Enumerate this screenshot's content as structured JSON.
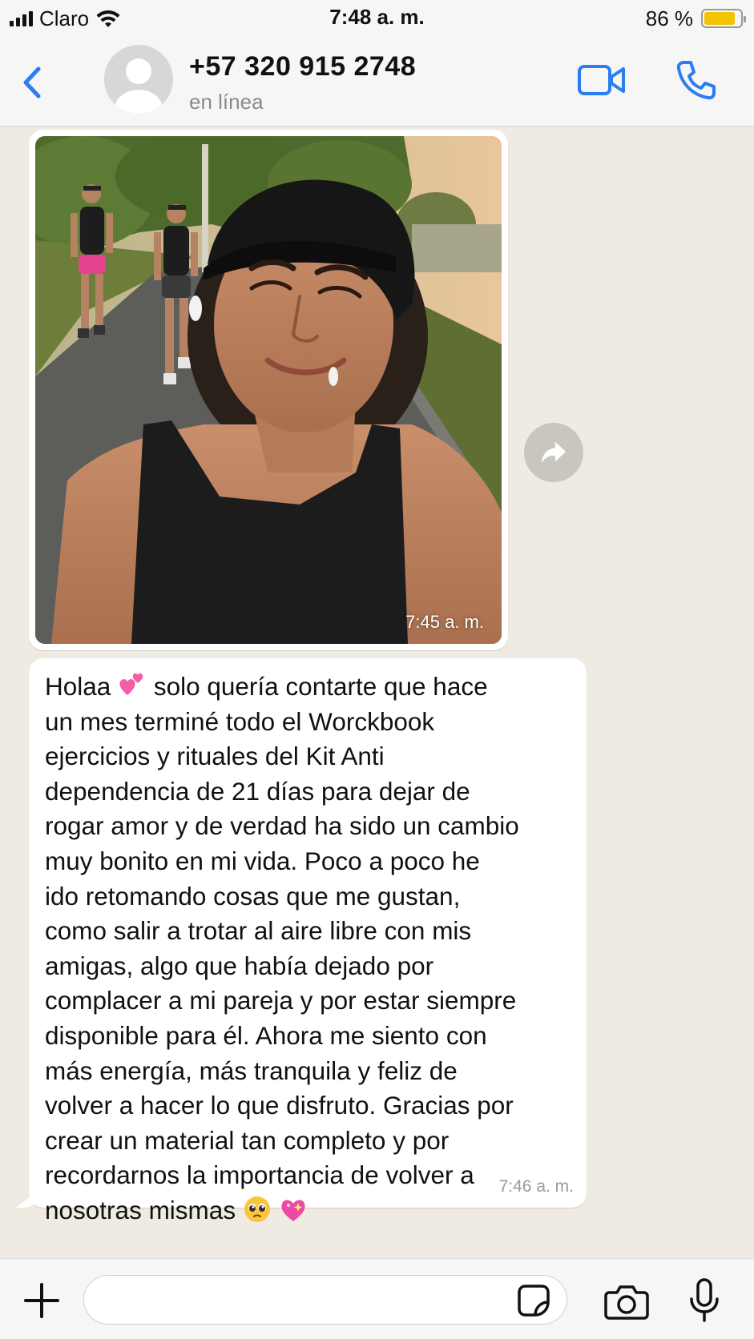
{
  "status_bar": {
    "carrier": "Claro",
    "time": "7:48 a. m.",
    "battery_percent": "86 %",
    "battery_level": 0.86,
    "battery_color": "#f5c400"
  },
  "header": {
    "contact_name": "+57 320 915 2748",
    "contact_status": "en línea",
    "accent_color": "#2a7ef0",
    "icons": [
      "chevron-left-icon",
      "avatar-placeholder-icon",
      "video-call-icon",
      "phone-icon"
    ]
  },
  "messages": [
    {
      "type": "image",
      "description_icon": "photo-image",
      "time": "7:45 a. m."
    },
    {
      "type": "text",
      "lines": [
        {
          "before": "Holaa ",
          "emoji": "two-hearts-emoji",
          "after": "  solo quería contarte que hace"
        },
        {
          "text": "un mes terminé todo el Worckbook"
        },
        {
          "text": "ejercicios y rituales del Kit Anti"
        },
        {
          "text": "dependencia de 21 días para dejar de"
        },
        {
          "text": "rogar amor y de verdad ha sido un cambio"
        },
        {
          "text": "muy bonito en mi vida. Poco a poco he"
        },
        {
          "text": "ido retomando cosas que me gustan,"
        },
        {
          "text": "como salir a trotar al aire libre con mis"
        },
        {
          "text": "amigas, algo que había dejado por"
        },
        {
          "text": "complacer a mi pareja y por estar siempre"
        },
        {
          "text": "disponible para él. Ahora me siento con"
        },
        {
          "text": "más energía, más tranquila y feliz de"
        },
        {
          "text": "volver a hacer lo que disfruto. Gracias por"
        },
        {
          "text": "crear un material tan completo y por"
        },
        {
          "text": "recordarnos la importancia de volver a"
        },
        {
          "before": "nosotras mismas ",
          "emojis": [
            "pleading-face-emoji",
            "sparkling-heart-emoji"
          ]
        }
      ],
      "time": "7:46 a. m."
    }
  ],
  "input_bar": {
    "placeholder": "",
    "icons": [
      "plus-icon",
      "sticker-icon",
      "camera-icon",
      "microphone-icon"
    ]
  }
}
